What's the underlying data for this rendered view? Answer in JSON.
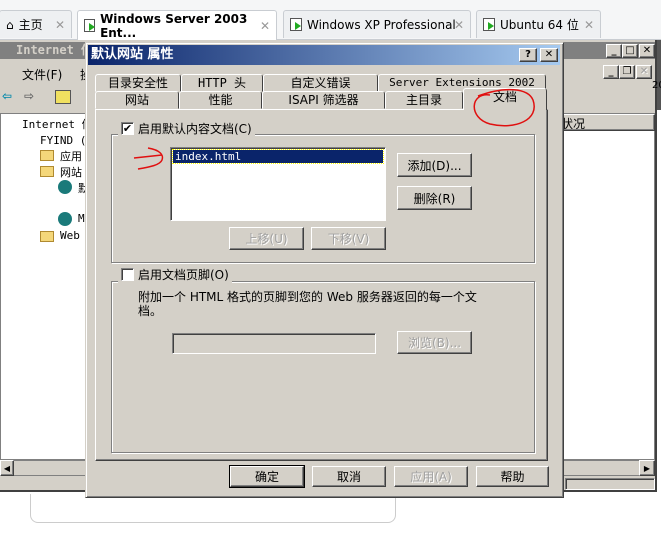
{
  "browser_tabs": [
    {
      "label": "主页",
      "icon": "home-icon"
    },
    {
      "label": "Windows Server 2003 Ent...",
      "icon": "vm-icon",
      "active": true
    },
    {
      "label": "Windows XP Professional",
      "icon": "vm-icon"
    },
    {
      "label": "Ubuntu 64 位",
      "icon": "vm-icon"
    }
  ],
  "close_glyph": "✕",
  "iis": {
    "title": "Internet 信",
    "menu_file": "文件(F)",
    "menu_next": "操",
    "tree": [
      "Internet 信",
      "FYIND (本",
      "应用",
      "网站",
      "默",
      "M",
      "Web ."
    ],
    "column_status": "状况",
    "right_edge": "20"
  },
  "dialog": {
    "title": "默认网站 属性",
    "help": "?",
    "close": "✕",
    "tabs_row1": [
      "目录安全性",
      "HTTP 头",
      "自定义错误",
      "Server Extensions 2002"
    ],
    "tabs_row2": [
      "网站",
      "性能",
      "ISAPI 筛选器",
      "主目录",
      "文档"
    ],
    "active_tab": "文档",
    "default_doc": {
      "checkbox_label": "启用默认内容文档(C)",
      "checked": true,
      "items": [
        "index.html"
      ],
      "selected": "index.html",
      "add": "添加(D)...",
      "remove": "删除(R)",
      "move_up": "上移(U)",
      "move_down": "下移(V)"
    },
    "footer": {
      "checkbox_label": "启用文档页脚(O)",
      "checked": false,
      "description": "附加一个 HTML 格式的页脚到您的 Web 服务器返回的每一个文档。",
      "path_value": "",
      "browse": "浏览(B)..."
    },
    "buttons": {
      "ok": "确定",
      "cancel": "取消",
      "apply": "应用(A)",
      "help": "帮助"
    }
  },
  "annotation_color": "#e01010",
  "title_gradient": [
    "#0a246a",
    "#a6caf0"
  ]
}
